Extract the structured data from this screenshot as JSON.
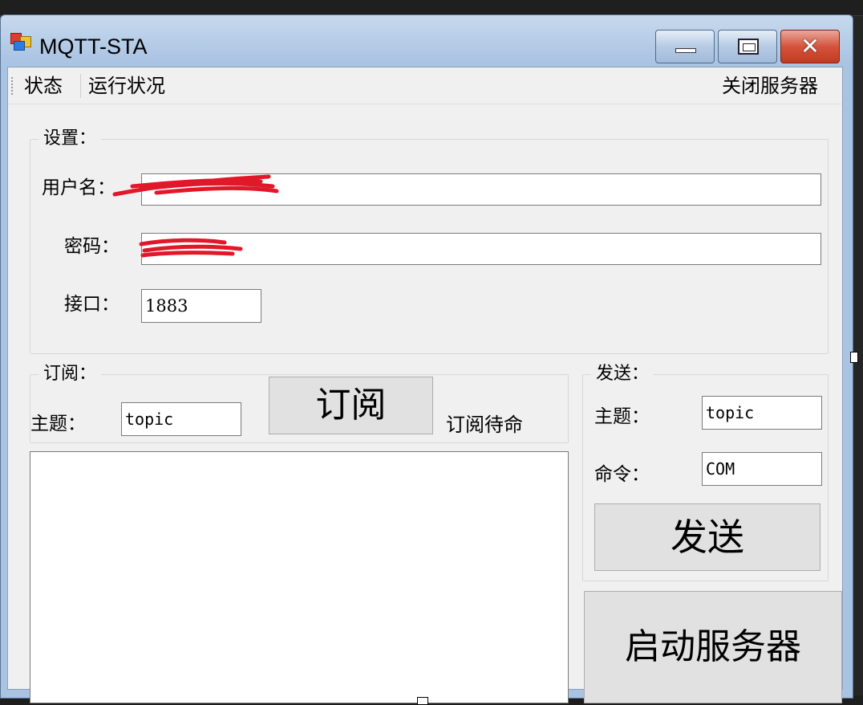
{
  "window": {
    "title": "MQTT-STA"
  },
  "menu": {
    "status": "状态",
    "run_status": "运行状况",
    "close_server": "关闭服务器"
  },
  "settings": {
    "legend": "设置：",
    "username_label": "用户名：",
    "username_value": "",
    "password_label": "密码：",
    "password_value": "",
    "port_label": "接口：",
    "port_value": "1883"
  },
  "subscribe": {
    "legend": "订阅：",
    "topic_label": "主题：",
    "topic_value": "topic",
    "button_label": "订阅",
    "status_text": "订阅待命"
  },
  "send": {
    "legend": "发送：",
    "topic_label": "主题：",
    "topic_value": "topic",
    "command_label": "命令：",
    "command_value": "COM",
    "button_label": "发送"
  },
  "start_button_label": "启动服务器",
  "colors": {
    "redaction": "#e0182a",
    "close_button": "#c9412a",
    "title_bar": "#a9c3e2"
  }
}
